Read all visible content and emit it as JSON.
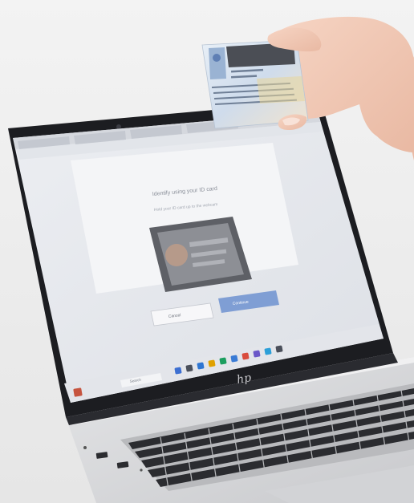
{
  "scene": {
    "description_visible": false
  },
  "screen": {
    "page_heading": "Identify using your ID card",
    "page_subtext": "Hold your ID card up to the webcam",
    "button_secondary": "Cancel",
    "button_primary": "Continue",
    "taskbar_search": "Search"
  },
  "colors": {
    "background": "#ececec",
    "laptop_silver": "#d8d9db",
    "bezel": "#1c1d21",
    "screen_bg": "#e9ebef",
    "primary_button": "#7f9ed4",
    "skin": "#f2c9b5"
  },
  "icons": [
    "hp-logo-icon",
    "webcam-icon",
    "usb-port-icon",
    "id-card-icon",
    "windows-start-icon"
  ]
}
